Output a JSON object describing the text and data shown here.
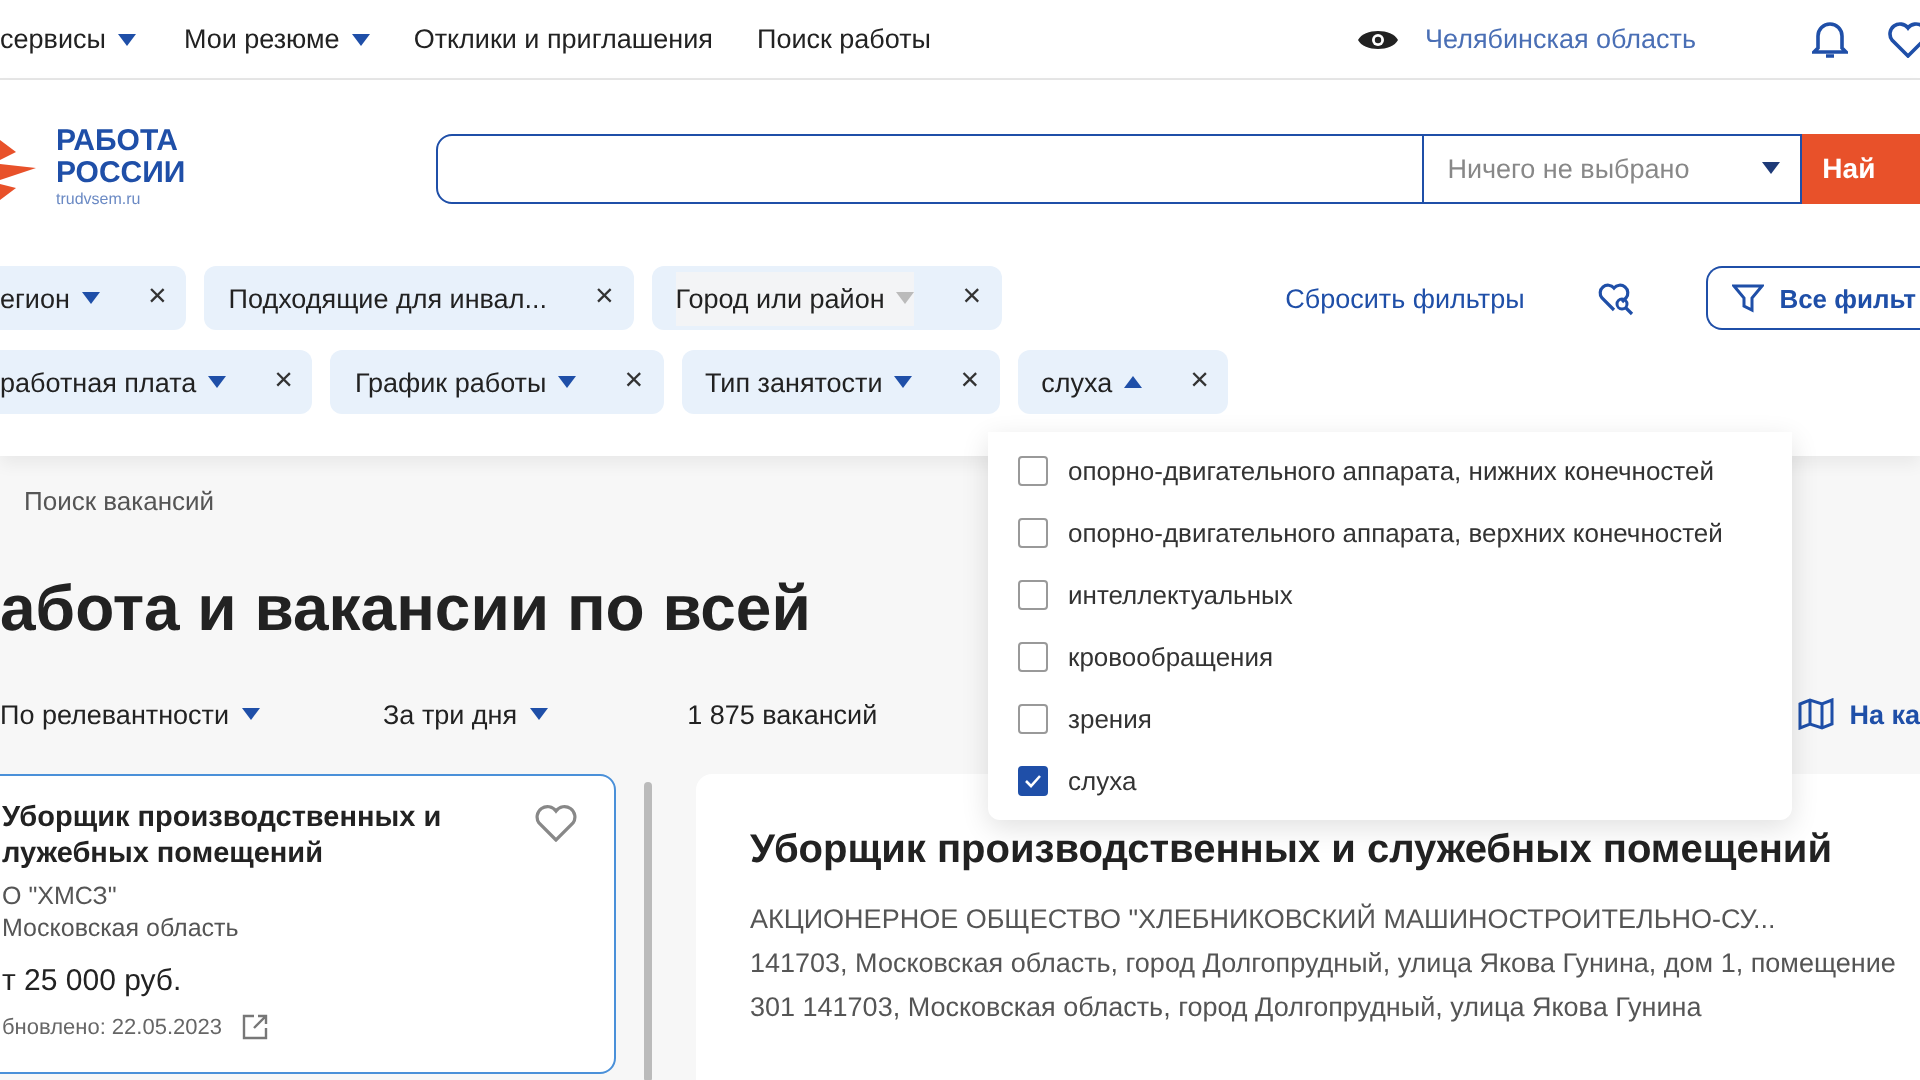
{
  "top_nav": {
    "items": [
      {
        "label": "сервисы",
        "kind": "menu"
      },
      {
        "label": "Мои резюме",
        "kind": "menu"
      },
      {
        "label": "Отклики и приглашения",
        "kind": "link"
      },
      {
        "label": "Поиск работы",
        "kind": "link"
      }
    ],
    "region": "Челябинская область"
  },
  "logo": {
    "line_1": "РАБОТА",
    "line_2": "РОССИИ",
    "site": "trudvsem.ru"
  },
  "search": {
    "select": "Ничего не выбрано",
    "button": "Най"
  },
  "filters": [
    [
      {
        "label": "егион",
        "kind": "menu",
        "expanded": false,
        "disabled": false,
        "close": "×"
      },
      {
        "label": "Подходящие для инвал...",
        "kind": "plain",
        "close": "×"
      },
      {
        "label": "Город или район",
        "kind": "menu",
        "expanded": false,
        "disabled": true,
        "close": "×"
      }
    ],
    [
      {
        "label": "работная плата",
        "kind": "menu",
        "expanded": false,
        "disabled": false,
        "close": "×"
      },
      {
        "label": "График работы",
        "kind": "menu",
        "expanded": false,
        "disabled": false,
        "close": "×"
      },
      {
        "label": "Тип занятости",
        "kind": "menu",
        "expanded": false,
        "disabled": false,
        "close": "×"
      },
      {
        "label": "слуха",
        "kind": "menu",
        "expanded": true,
        "disabled": false,
        "close": "×"
      }
    ]
  ],
  "reset_filters": "Сбросить фильтры",
  "all_filters": "Все фильт",
  "dropdown": [
    {
      "label": "опорно-двигательного аппарата, нижних конечностей",
      "checked": false
    },
    {
      "label": "опорно-двигательного аппарата, верхних конечностей",
      "checked": false
    },
    {
      "label": "интеллектуальных",
      "checked": false
    },
    {
      "label": "кровообращения",
      "checked": false
    },
    {
      "label": "зрения",
      "checked": false
    },
    {
      "label": "слуха",
      "checked": true
    }
  ],
  "breadcrumb": "Поиск вакансий",
  "heading": "абота и вакансии по всей",
  "sort": [
    {
      "label": "По релевантности"
    },
    {
      "label": "За три дня"
    }
  ],
  "count": "1 875 вакансий",
  "map_link": "На ка",
  "vacancy_card": {
    "title_1": "Уборщик производственных и",
    "title_2": "лужебных помещений",
    "company": "О \"ХМСЗ\"",
    "region": "Московская область",
    "salary": "т 25 000 руб.",
    "updated": "бновлено: 22.05.2023",
    "selected": true
  },
  "detail": {
    "title": "Уборщик производственных и служебных помещений",
    "company": "АКЦИОНЕРНОЕ ОБЩЕСТВО \"ХЛЕБНИКОВСКИЙ МАШИНОСТРОИТЕЛЬНО-СУ...",
    "address": "141703, Московская область, город Долгопрудный, улица Якова Гунина, дом 1, помещение 301 141703, Московская область, город Долгопрудный, улица Якова Гунина"
  }
}
